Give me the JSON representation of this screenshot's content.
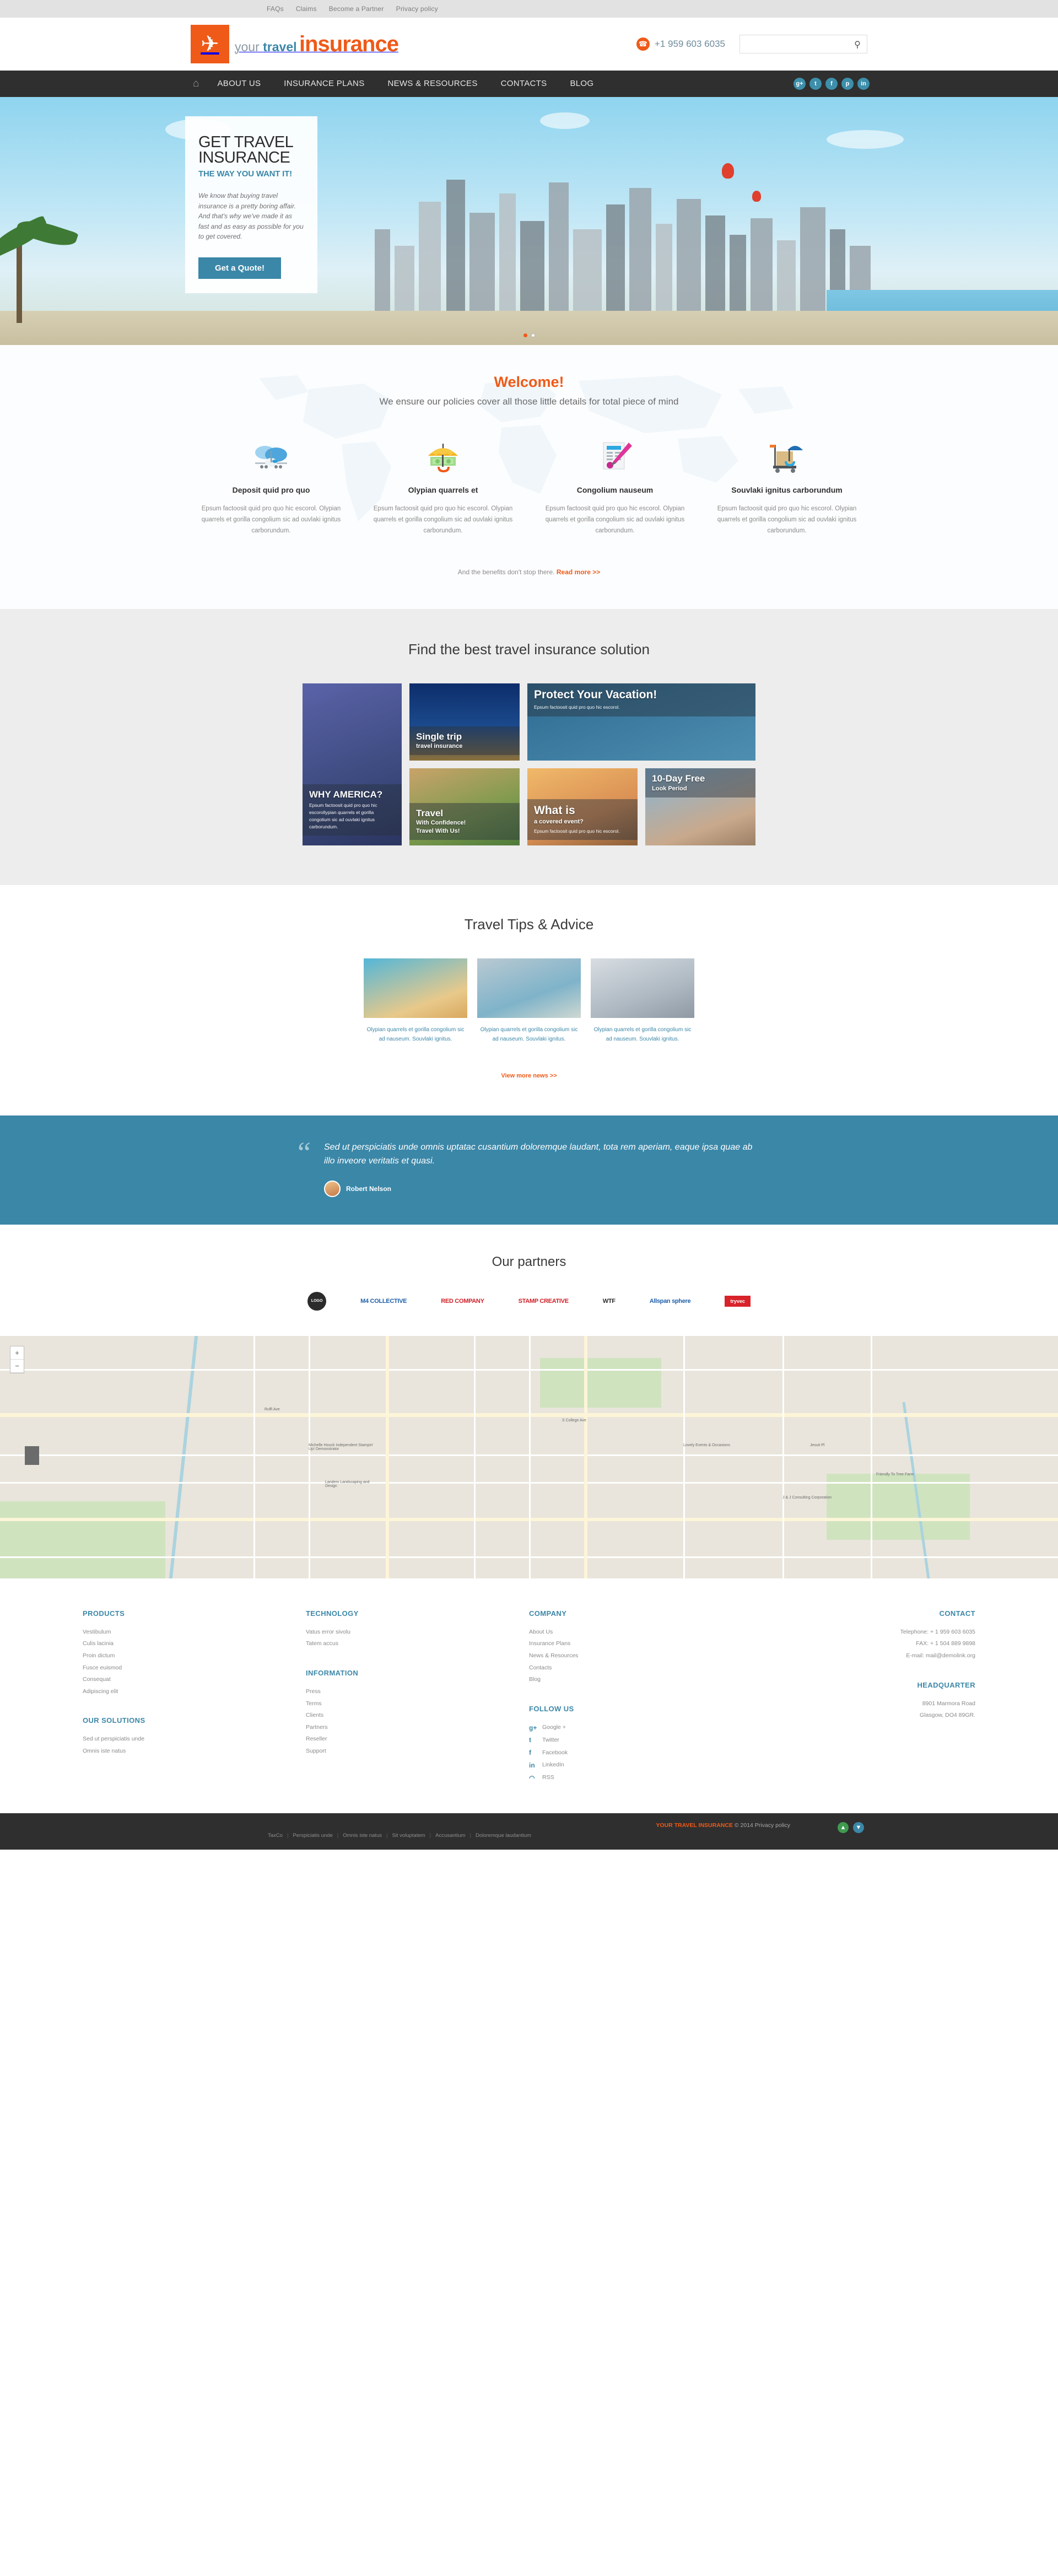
{
  "topbar": {
    "links": [
      "FAQs",
      "Claims",
      "Become a Partner",
      "Privacy policy"
    ]
  },
  "header": {
    "logo": {
      "icon": "airplane-icon",
      "line1_light": "your ",
      "line1_bold": "travel",
      "line2": "insurance"
    },
    "phone": "+1 959 603 6035",
    "phone_icon": "phone-icon",
    "search_placeholder": "",
    "search_value": "",
    "search_icon": "search-icon"
  },
  "nav": {
    "home_icon": "home-icon",
    "items": [
      "ABOUT US",
      "INSURANCE PLANS",
      "NEWS & RESOURCES",
      "CONTACTS",
      "BLOG"
    ],
    "socials": [
      {
        "name": "googleplus-icon",
        "glyph": "g+"
      },
      {
        "name": "twitter-icon",
        "glyph": "t"
      },
      {
        "name": "facebook-icon",
        "glyph": "f"
      },
      {
        "name": "pinterest-icon",
        "glyph": "p"
      },
      {
        "name": "linkedin-icon",
        "glyph": "in"
      }
    ]
  },
  "hero": {
    "title_line1": "GET TRAVEL",
    "title_line2": "INSURANCE",
    "subtitle": "THE WAY YOU WANT IT!",
    "paragraph": "We know that buying travel insurance is a pretty boring affair. And that's why we've made it as fast and as easy as possible for you to get covered.",
    "button": "Get a Quote!",
    "slides": 2,
    "active_slide": 1
  },
  "welcome": {
    "title": "Welcome!",
    "lead": "We ensure our policies cover all those little details for total piece of mind",
    "features": [
      {
        "icon": "airplane-cloud-icon",
        "title": "Deposit quid pro quo",
        "text": "Epsum factoosit quid pro quo hic escorol. Olypian quarrels et gorilla congolium sic ad ouvlaki ignitus carborundum."
      },
      {
        "icon": "umbrella-money-icon",
        "title": "Olypian quarrels et",
        "text": "Epsum factoosit quid pro quo hic escorol. Olypian quarrels et gorilla congolium sic ad ouvlaki ignitus carborundum."
      },
      {
        "icon": "document-pen-icon",
        "title": "Congolium nauseum",
        "text": "Epsum factoosit quid pro quo hic escorol. Olypian quarrels et gorilla congolium sic ad ouvlaki ignitus carborundum."
      },
      {
        "icon": "luggage-cart-umbrella-icon",
        "title": "Souvlaki ignitus carborundum",
        "text": "Epsum factoosit quid pro quo hic escorol. Olypian quarrels et gorilla congolium sic ad ouvlaki ignitus carborundum."
      }
    ],
    "benefits_text": "And the benefits don't stop there.",
    "benefits_link": "Read more >>"
  },
  "gallery": {
    "title": "Find the best travel insurance solution",
    "tiles": [
      {
        "title": "WHY AMERICA?",
        "subtitle": "",
        "text": "Epsum factoosit quid pro quo hic escorollypian quarrels et gorilla congolium sic ad ouvlaki ignitus carborundum."
      },
      {
        "title": "Single trip",
        "subtitle": "travel insurance",
        "text": ""
      },
      {
        "title": "Protect Your Vacation!",
        "subtitle": "",
        "text": "Epsum factoosit quid pro quo hic escorol."
      },
      {
        "title": "Travel",
        "subtitle": "With Confidence!",
        "text": "Travel With Us!"
      },
      {
        "title": "What is",
        "subtitle": "a covered event?",
        "text": "Epsum factoosit quid pro quo hic escorol."
      },
      {
        "title": "10-Day Free",
        "subtitle": "Look Period",
        "text": ""
      }
    ]
  },
  "tips": {
    "title": "Travel Tips & Advice",
    "items": [
      {
        "text": "Olypian quarrels et gorilla congolium sic ad nauseum. Souvlaki ignitus."
      },
      {
        "text": "Olypian quarrels et gorilla congolium sic ad nauseum. Souvlaki ignitus."
      },
      {
        "text": "Olypian quarrels et gorilla congolium sic ad nauseum. Souvlaki ignitus."
      }
    ],
    "more_link": "View more news >>"
  },
  "testimonial": {
    "quote": "Sed ut perspiciatis unde omnis uptatac cusantium doloremque laudant, tota rem aperiam, eaque ipsa quae ab illo inveore veritatis et quasi.",
    "author": "Robert Nelson",
    "avatar": "avatar-icon"
  },
  "partners": {
    "title": "Our partners",
    "logos": [
      {
        "name": "circle-badge-logo",
        "label": "LOGO"
      },
      {
        "name": "m4-collective-logo",
        "label": "M4 COLLECTIVE"
      },
      {
        "name": "red-company-logo",
        "label": "RED COMPANY"
      },
      {
        "name": "stamp-creative-logo",
        "label": "STAMP CREATIVE"
      },
      {
        "name": "wtf-logo",
        "label": "WTF"
      },
      {
        "name": "allspan-sphere-logo",
        "label": "Allspan sphere"
      },
      {
        "name": "tryvec-logo",
        "label": "tryvec"
      }
    ]
  },
  "map": {
    "zoom_in": "+",
    "zoom_out": "−",
    "labels": [
      "Michelle Houck Independent Stampin' Up! Demonstrator",
      "Landers Landscaping and Design",
      "Ruffi Ave",
      "S College Ave",
      "Lovely Events & Occasions",
      "Jesuit Pl",
      "J & J Consulting Corporation",
      "Friendly To Tree Farm"
    ]
  },
  "footer": {
    "col1": {
      "heading1": "PRODUCTS",
      "links1": [
        "Vestibulum",
        "Culis lacinia",
        "Proin dictum",
        "Fusce euismod",
        "Consequat",
        "Adipiscing elit"
      ],
      "heading2": "OUR SOLUTIONS",
      "links2": [
        "Sed ut perspiciatis unde",
        "Omnis iste natus"
      ]
    },
    "col2": {
      "heading1": "TECHNOLOGY",
      "links1": [
        "Vatus error sivolu",
        "Tatem accus"
      ],
      "heading2": "INFORMATION",
      "links2": [
        "Press",
        "Terms",
        "Clients",
        "Partners",
        "Reseller",
        "Support"
      ]
    },
    "col3": {
      "heading1": "COMPANY",
      "links1": [
        "About Us",
        "Insurance Plans",
        "News & Resources",
        "Contacts",
        "Blog"
      ],
      "heading2": "FOLLOW US",
      "socials": [
        {
          "icon": "googleplus-icon",
          "glyph": "g+",
          "label": "Google +"
        },
        {
          "icon": "twitter-icon",
          "glyph": "t",
          "label": "Twitter"
        },
        {
          "icon": "facebook-icon",
          "glyph": "f",
          "label": "Facebook"
        },
        {
          "icon": "linkedin-icon",
          "glyph": "in",
          "label": "LinkedIn"
        },
        {
          "icon": "rss-icon",
          "glyph": "◠",
          "label": "RSS"
        }
      ]
    },
    "col4": {
      "heading1": "CONTACT",
      "telephone": "Telephone:  + 1 959 603 6035",
      "fax": "FAX:  + 1 504 889 9898",
      "email": "E-mail: mail@demolink.org",
      "heading2": "HEADQUARTER",
      "address1": "8901 Marmora Road",
      "address2": "Glasgow, DO4 89GR."
    }
  },
  "bottom": {
    "brand": "YOUR TRAVEL INSURANCE",
    "copyright": "© 2014 Privacy policy",
    "links": [
      "TaxCo",
      "Perspiciatis unde",
      "Omnis iste natus",
      "Sit voluptatem",
      "Accusantium",
      "Doloremque laudantium"
    ],
    "btn_up": "▲",
    "btn_down": "▼"
  }
}
